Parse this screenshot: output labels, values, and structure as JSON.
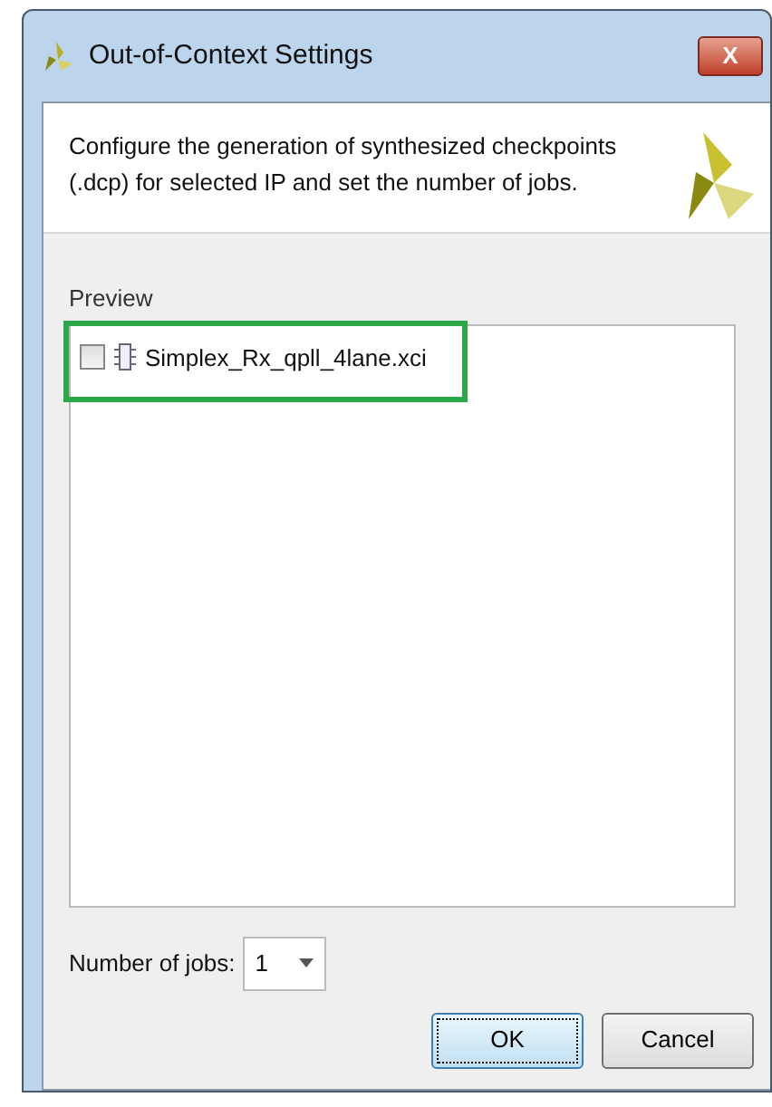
{
  "window": {
    "title": "Out-of-Context Settings",
    "close": "X"
  },
  "header": {
    "description": "Configure the generation of synthesized checkpoints (.dcp) for selected IP and set the number of jobs."
  },
  "preview": {
    "label": "Preview",
    "items": [
      {
        "name": "Simplex_Rx_qpll_4lane.xci",
        "checked": false,
        "highlighted": true
      }
    ]
  },
  "jobs": {
    "label": "Number of jobs:",
    "value": "1"
  },
  "buttons": [
    {
      "label": "OK",
      "focused": true
    },
    {
      "label": "Cancel",
      "focused": false
    }
  ]
}
